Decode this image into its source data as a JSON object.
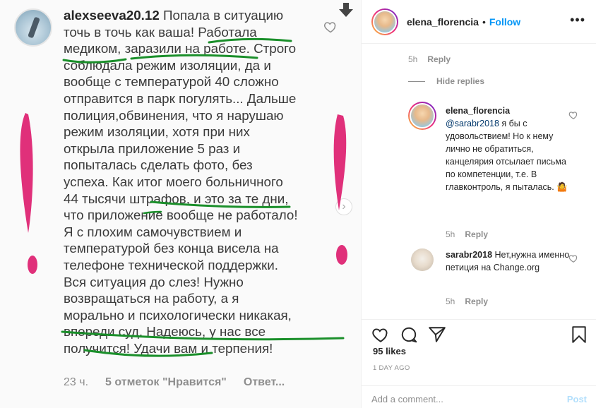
{
  "photo": {
    "username": "alexseeva20.12",
    "body": " Попала в ситуацию точь в точь как ваша! Работала медиком, заразили на работе. Строго соблюдала режим изоляции, да и вообще с температурой 40 сложно отправится в парк погулять... Дальше полиция,обвинения, что я нарушаю режим изоляции, хотя при них открыла приложение 5 раз и попыталась сделать фото, без успеха. Как итог моего больничного 44 тысячи штрафов, и это за те дни, что приложение вообще не работало! Я с плохим самочувствием и температурой без конца висела на телефоне технической поддержки. Вся ситуация до слез! Нужно возвращаться на работу, а я морально и психологически никакая, впереди суд. Надеюсь, у нас все получится! Удачи вам и терпения!",
    "time": "23 ч.",
    "likes": "5 отметок \"Нравится\"",
    "reply": "Ответ..."
  },
  "header": {
    "username": "elena_florencia",
    "dot": "•",
    "follow": "Follow",
    "more": "•••"
  },
  "thread": {
    "top_meta": {
      "time": "5h",
      "reply": "Reply"
    },
    "hide_replies": "Hide replies",
    "comments": [
      {
        "username": "elena_florencia",
        "mention": "@sarabr2018",
        "text": " я бы с удовольствием! Но к нему лично не обратиться, канцелярия отсылает письма по компетенции, т.е. В главконтроль, я пыталась. 🤷",
        "time": "5h",
        "reply": "Reply"
      },
      {
        "username": "sarabr2018",
        "text": " Нет,нужна именно петиция на Change.org",
        "time": "5h",
        "reply": "Reply"
      }
    ]
  },
  "actions": {
    "likes": "95 likes",
    "time_ago": "1 DAY AGO"
  },
  "composer": {
    "placeholder": "Add a comment...",
    "post": "Post"
  },
  "colors": {
    "follow_blue": "#0095f6",
    "marker_green": "#1a8f2a",
    "marker_pink": "#e0307a"
  }
}
